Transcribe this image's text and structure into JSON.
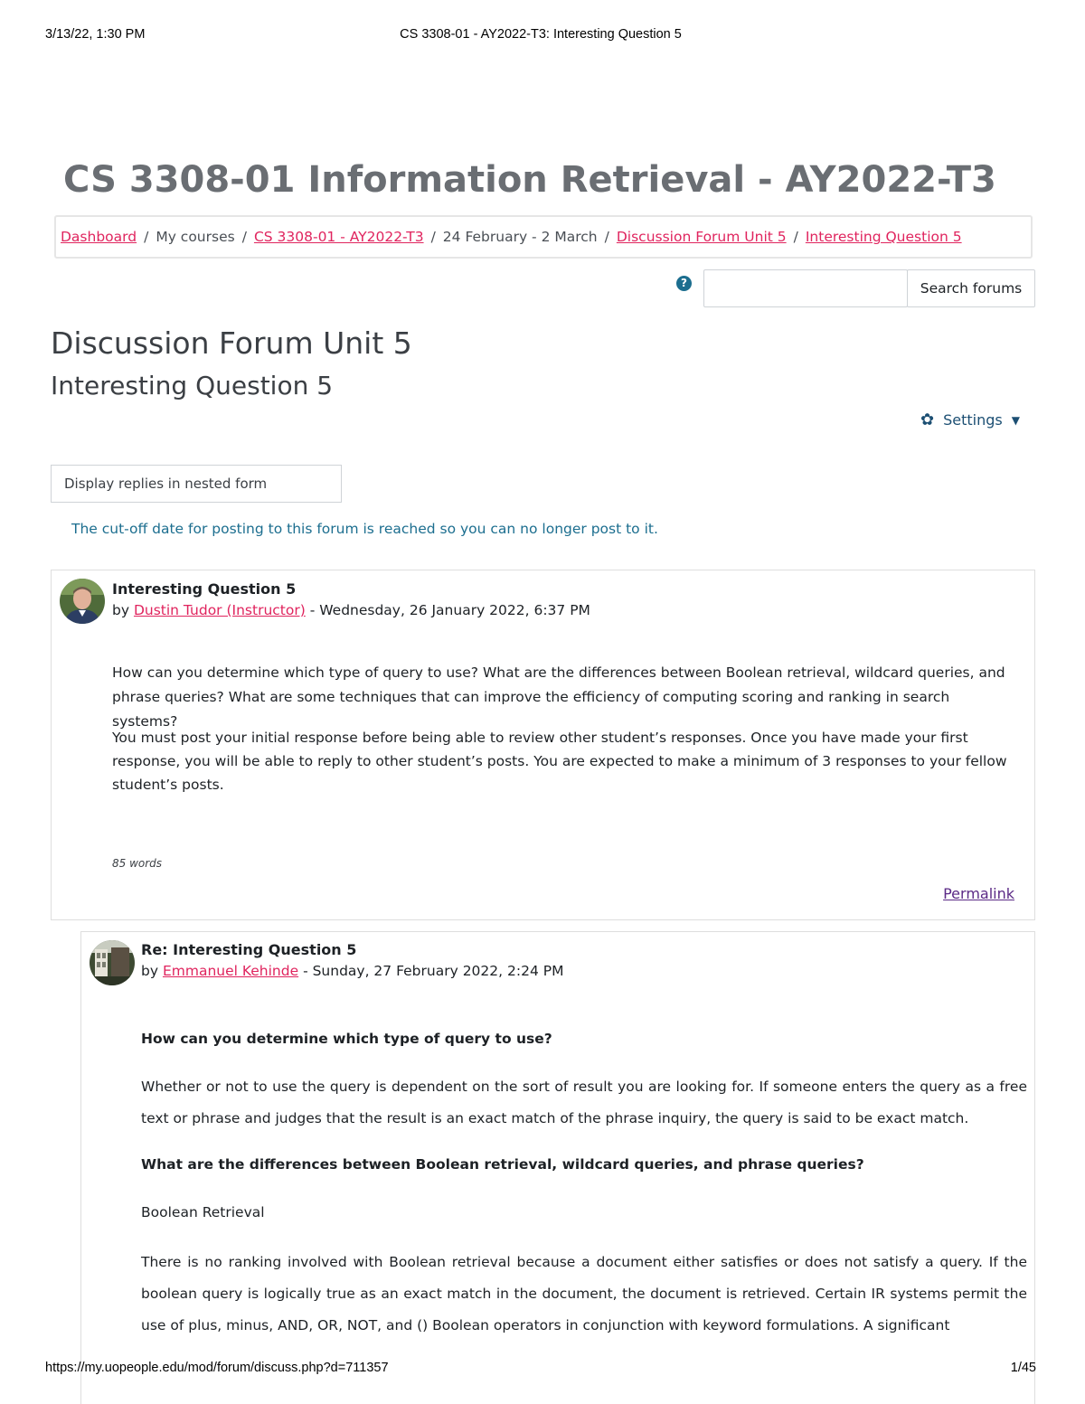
{
  "print_header": {
    "datetime": "3/13/22, 1:30 PM",
    "page_title": "CS 3308-01 - AY2022-T3: Interesting Question 5"
  },
  "course_title": "CS 3308-01 Information Retrieval - AY2022-T3",
  "breadcrumb": [
    {
      "label": "Dashboard",
      "link": true
    },
    {
      "label": "My courses",
      "link": false
    },
    {
      "label": "CS 3308-01 - AY2022-T3",
      "link": true
    },
    {
      "label": "24 February - 2 March",
      "link": false
    },
    {
      "label": "Discussion Forum Unit 5",
      "link": true
    },
    {
      "label": "Interesting Question 5",
      "link": true
    }
  ],
  "search": {
    "placeholder": "",
    "button_label": "Search forums",
    "help_icon": "question-circle-icon"
  },
  "forum_title": "Discussion Forum Unit 5",
  "discussion_title": "Interesting Question 5",
  "settings_label": "Settings",
  "display_mode": "Display replies in nested form",
  "cutoff_notice": "The cut-off date for posting to this forum is reached so you can no longer post to it.",
  "posts": [
    {
      "subject": "Interesting Question 5",
      "by_prefix": "by",
      "author": "Dustin Tudor (Instructor)",
      "date": "- Wednesday, 26 January 2022, 6:37 PM",
      "paragraphs": [
        "How can you determine which type of query to use?  What are the differences between Boolean retrieval, wildcard queries, and phrase queries?  What are some techniques that can improve the efficiency of computing scoring and ranking in search systems?",
        "You must post your initial response before being able to review other student’s responses. Once you have made your first response, you will be able to reply to other student’s posts. You are expected to make a minimum of 3 responses to your fellow student’s posts."
      ],
      "word_count": "85 words",
      "permalink": "Permalink"
    },
    {
      "subject": "Re: Interesting Question 5",
      "by_prefix": "by",
      "author": "Emmanuel Kehinde",
      "date": "- Sunday, 27 February 2022, 2:24 PM",
      "question1": "How can you determine which type of query to use?",
      "answer1": "Whether or not to use the query is dependent on the sort of result you are looking for. If someone enters the query as a free text or phrase and judges that the result is an exact match of the phrase inquiry, the query is said to be exact match.",
      "question2": "What are the differences between Boolean retrieval, wildcard queries, and phrase queries?",
      "heading1": "Boolean Retrieval",
      "answer2": "There is no ranking involved with Boolean retrieval because a document either satisfies or does not satisfy a query. If the boolean query is logically true as an exact match in the document, the document is retrieved. Certain IR systems permit the use of plus, minus, AND, OR, NOT, and () Boolean operators in conjunction with keyword formulations. A significant"
    }
  ],
  "print_footer": {
    "url": "https://my.uopeople.edu/mod/forum/discuss.php?d=711357",
    "page_number": "1/45"
  },
  "colors": {
    "link": "#e0245e",
    "title_gray": "#6a6e73",
    "notice_teal": "#1c6e8f",
    "permalink_purple": "#5b2a86"
  }
}
